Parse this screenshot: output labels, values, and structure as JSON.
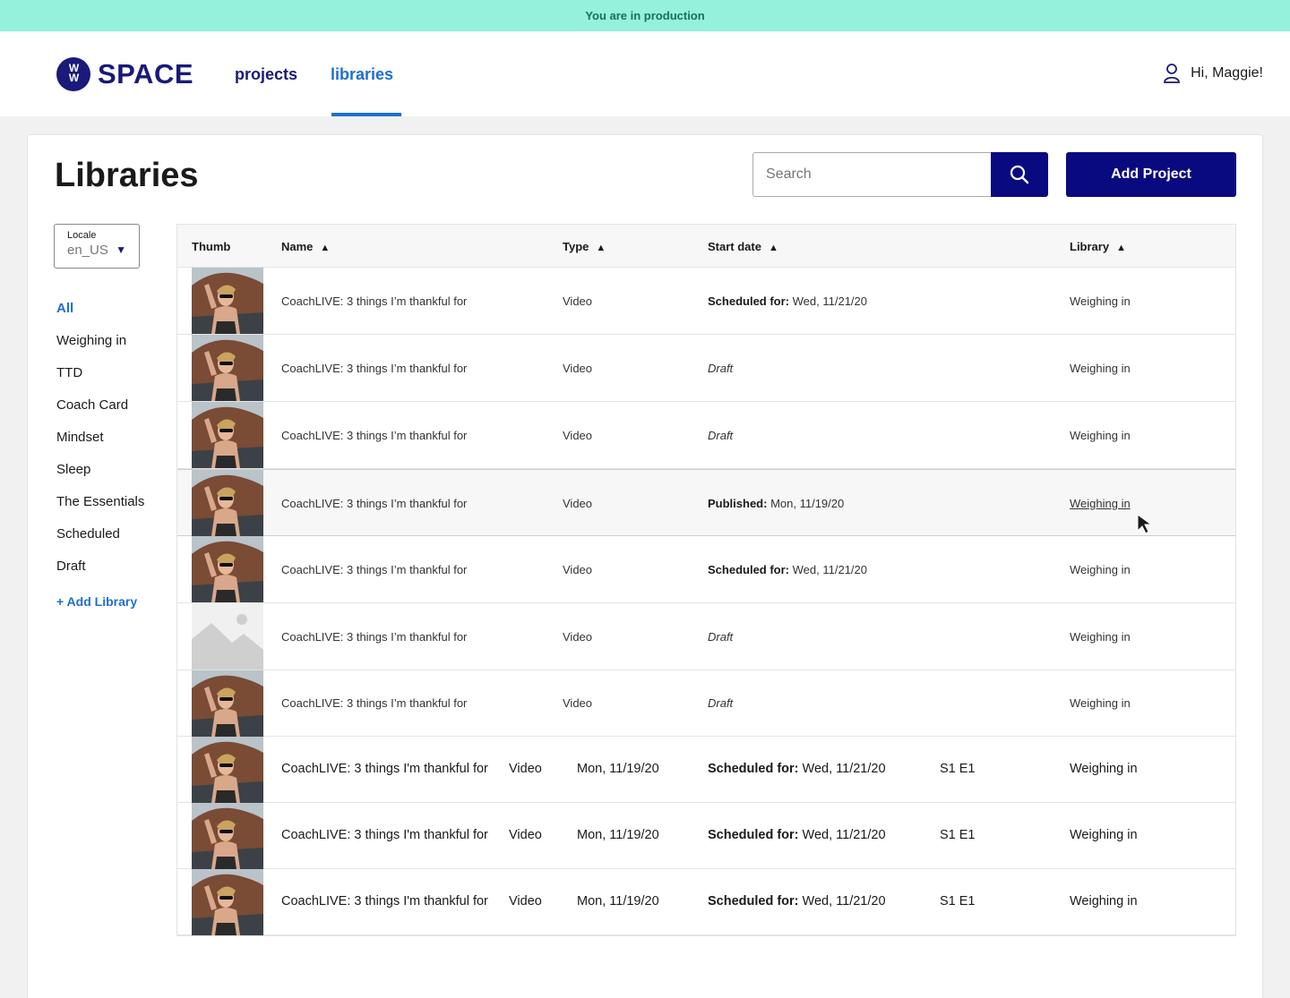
{
  "banner": {
    "text": "You are in production"
  },
  "header": {
    "logo_mark": "WW",
    "logo_text": "SPACE",
    "nav": [
      {
        "label": "projects"
      },
      {
        "label": "libraries"
      }
    ],
    "greeting": "Hi, Maggie!"
  },
  "page": {
    "title": "Libraries",
    "search_placeholder": "Search",
    "add_button": "Add Project"
  },
  "locale": {
    "label": "Locale",
    "value": "en_US"
  },
  "sidebar": {
    "items": [
      {
        "label": "All"
      },
      {
        "label": "Weighing in"
      },
      {
        "label": "TTD"
      },
      {
        "label": "Coach Card"
      },
      {
        "label": "Mindset"
      },
      {
        "label": "Sleep"
      },
      {
        "label": "The Essentials"
      },
      {
        "label": "Scheduled"
      },
      {
        "label": "Draft"
      }
    ],
    "add_label": "+ Add Library"
  },
  "table": {
    "headers": {
      "thumb": "Thumb",
      "name": "Name",
      "type": "Type",
      "start": "Start date",
      "library": "Library"
    },
    "rows": [
      {
        "name": "CoachLIVE: 3 things I’m thankful for",
        "type": "Video",
        "status_label": "Scheduled for:",
        "status_date": "Wed, 11/21/20",
        "library": "Weighing in"
      },
      {
        "name": "CoachLIVE: 3 things I’m thankful for",
        "type": "Video",
        "status_label": "",
        "status_date": "Draft",
        "library": "Weighing in"
      },
      {
        "name": "CoachLIVE: 3 things I’m thankful for",
        "type": "Video",
        "status_label": "",
        "status_date": "Draft",
        "library": "Weighing in"
      },
      {
        "name": "CoachLIVE: 3 things I’m thankful for",
        "type": "Video",
        "status_label": "Published:",
        "status_date": "Mon, 11/19/20",
        "library": "Weighing in"
      },
      {
        "name": "CoachLIVE: 3 things I’m thankful for",
        "type": "Video",
        "status_label": "Scheduled for:",
        "status_date": "Wed, 11/21/20",
        "library": "Weighing in"
      },
      {
        "name": "CoachLIVE: 3 things I’m thankful for",
        "type": "Video",
        "status_label": "",
        "status_date": "Draft",
        "library": "Weighing in"
      },
      {
        "name": "CoachLIVE: 3 things I’m thankful for",
        "type": "Video",
        "status_label": "",
        "status_date": "Draft",
        "library": "Weighing in"
      }
    ],
    "wide_rows": [
      {
        "name": "CoachLIVE: 3 things I'm thankful for",
        "type": "Video",
        "date": "Mon, 11/19/20",
        "status_label": "Scheduled for:",
        "status_date": "Wed, 11/21/20",
        "episode": "S1 E1",
        "library": "Weighing in"
      },
      {
        "name": "CoachLIVE: 3 things I'm thankful for",
        "type": "Video",
        "date": "Mon, 11/19/20",
        "status_label": "Scheduled for:",
        "status_date": "Wed, 11/21/20",
        "episode": "S1 E1",
        "library": "Weighing in"
      },
      {
        "name": "CoachLIVE: 3 things I'm thankful for",
        "type": "Video",
        "date": "Mon, 11/19/20",
        "status_label": "Scheduled for:",
        "status_date": "Wed, 11/21/20",
        "episode": "S1 E1",
        "library": "Weighing in"
      }
    ]
  },
  "colors": {
    "banner": "#95f0dc",
    "primary": "#0a0a80",
    "accent": "#1f6fd1"
  },
  "icons": {
    "user": "user-icon",
    "search": "search-icon",
    "caret": "caret-down-icon",
    "sort": "sort-up-icon",
    "cursor": "mouse-pointer-icon"
  }
}
